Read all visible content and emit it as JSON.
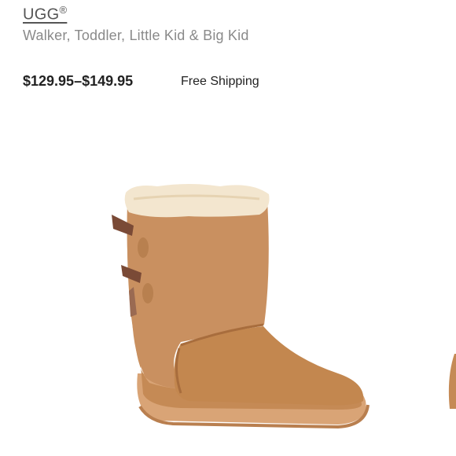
{
  "product": {
    "brand": "UGG",
    "brand_mark": "®",
    "subtitle": "Walker, Toddler, Little Kid & Big Kid",
    "price": "$129.95–$149.95",
    "shipping": "Free Shipping"
  },
  "colors": {
    "boot": "#c58a55",
    "boot_shadow": "#a86d3d",
    "fleece": "#f3e6cf",
    "sole": "#d9a476",
    "bow": "#7a4a36"
  }
}
